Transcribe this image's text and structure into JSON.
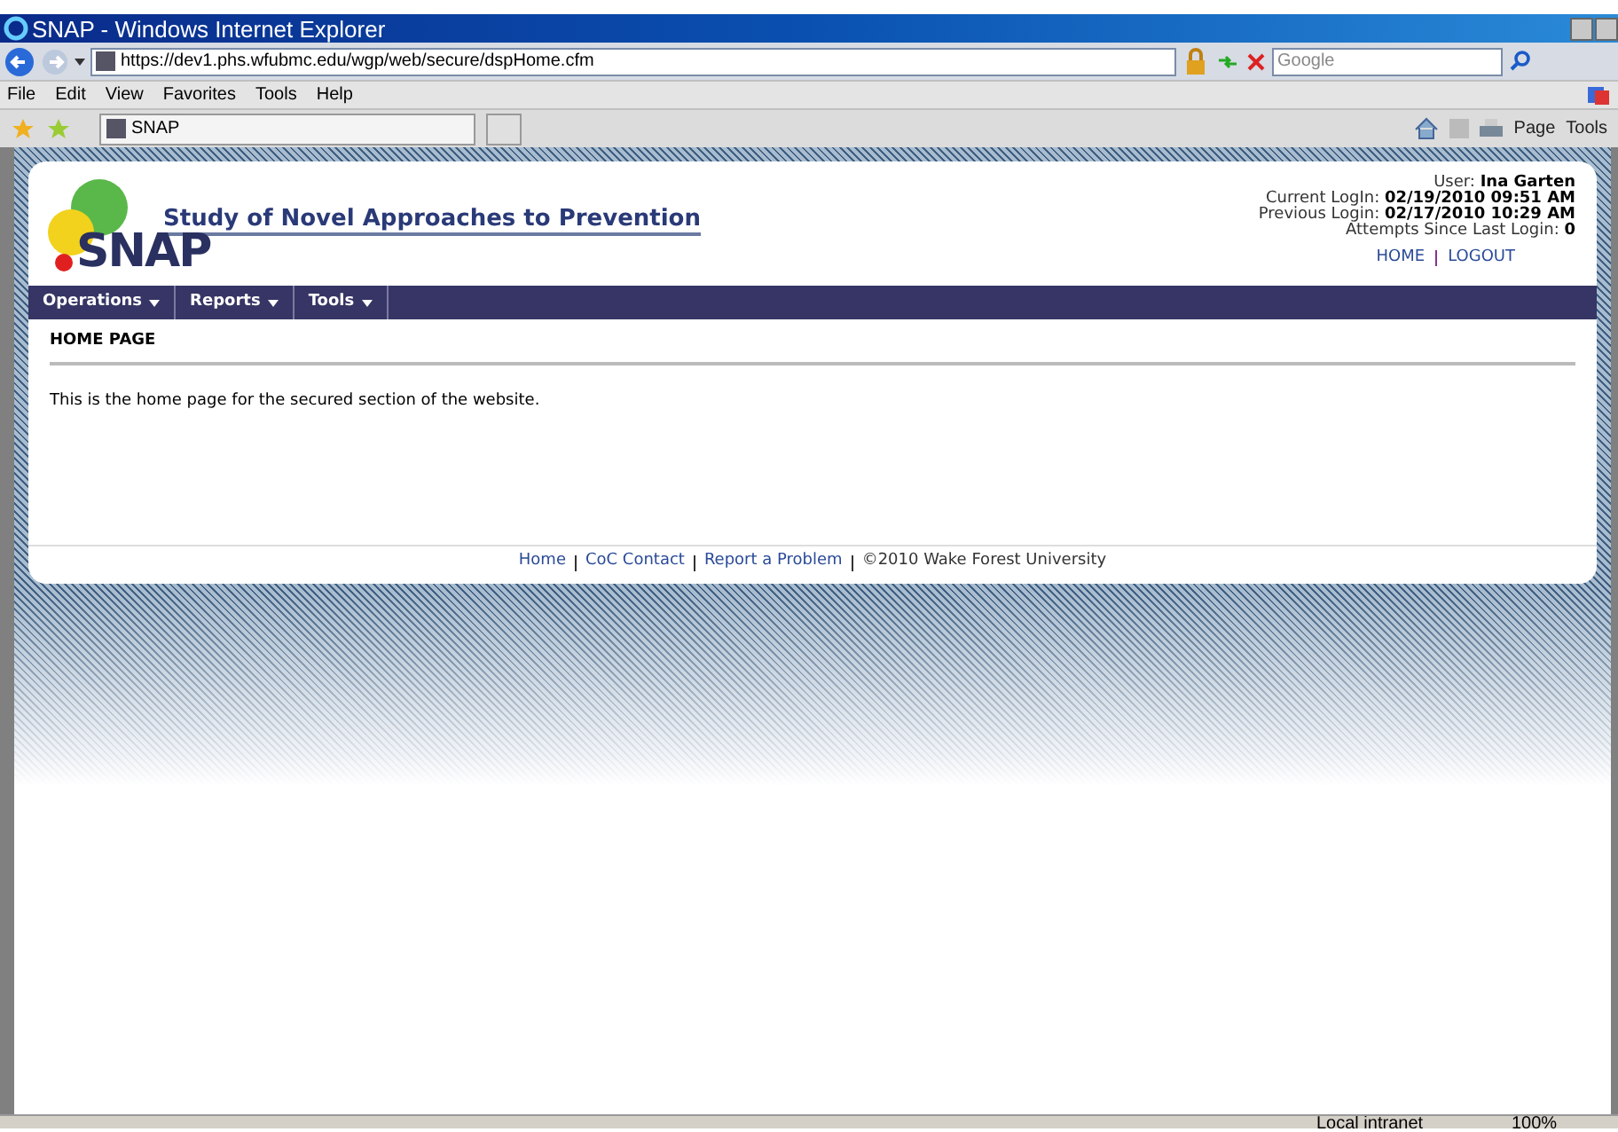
{
  "window": {
    "title": "SNAP - Windows Internet Explorer"
  },
  "address_bar": {
    "url": "https://dev1.phs.wfubmc.edu/wgp/web/secure/dspHome.cfm"
  },
  "search": {
    "placeholder": "Google"
  },
  "menu": [
    "File",
    "Edit",
    "View",
    "Favorites",
    "Tools",
    "Help"
  ],
  "favorites_tab": {
    "label": "SNAP"
  },
  "command_bar": [
    "Page",
    "Tools"
  ],
  "site": {
    "title": "Study of Novel Approaches to Prevention",
    "logo_text": "SNAP",
    "user_info": [
      {
        "label": "User:",
        "value": "Ina Garten"
      },
      {
        "label": "Current LogIn:",
        "value": "02/19/2010 09:51 AM"
      },
      {
        "label": "Previous Login:",
        "value": "02/17/2010 10:29 AM"
      },
      {
        "label": "Attempts Since Last Login:",
        "value": "0"
      }
    ],
    "header_links": [
      "HOME",
      "LOGOUT"
    ],
    "nav": [
      "Operations",
      "Reports",
      "Tools"
    ],
    "heading": "HOME PAGE",
    "body": "This is the home page for the secured section of the website.",
    "footer_links": [
      "Home",
      "CoC Contact",
      "Report a Problem"
    ],
    "copyright": "©2010 Wake Forest University"
  },
  "status_bar": {
    "zone": "Local intranet",
    "zoom": "100%"
  }
}
